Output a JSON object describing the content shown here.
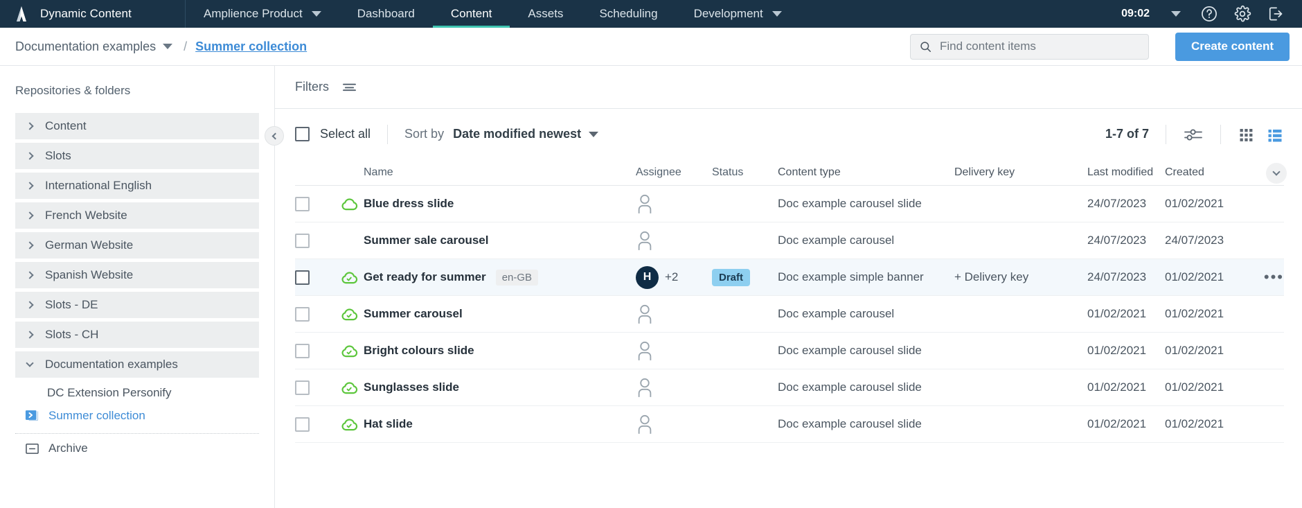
{
  "topnav": {
    "logo_icon": "amplience-logo-icon",
    "brand": "Dynamic Content",
    "product_switcher": {
      "label": "Amplience Product",
      "icon": "chevron-down-icon"
    },
    "items": [
      {
        "label": "Dashboard",
        "active": false
      },
      {
        "label": "Content",
        "active": true
      },
      {
        "label": "Assets",
        "active": false
      },
      {
        "label": "Scheduling",
        "active": false
      },
      {
        "label": "Development",
        "active": false,
        "icon": "chevron-down-icon"
      }
    ],
    "clock": "09:02",
    "clock_caret_icon": "chevron-down-icon",
    "help_icon": "help-circle-icon",
    "settings_icon": "gear-icon",
    "logout_icon": "logout-icon"
  },
  "breadcrumb": {
    "root": "Documentation examples",
    "root_caret_icon": "chevron-down-icon",
    "separator": "/",
    "current": "Summer collection"
  },
  "search": {
    "icon": "search-icon",
    "value": "",
    "placeholder": "Find content items"
  },
  "create_button": {
    "label": "Create content",
    "color": "#4a9ae0"
  },
  "sidebar": {
    "heading": "Repositories & folders",
    "collapse_icon": "chevron-left-icon",
    "items": [
      {
        "label": "Content",
        "icon": "chevron-right-icon",
        "expanded": false
      },
      {
        "label": "Slots",
        "icon": "chevron-right-icon",
        "expanded": false
      },
      {
        "label": "International English",
        "icon": "chevron-right-icon",
        "expanded": false
      },
      {
        "label": "French Website",
        "icon": "chevron-right-icon",
        "expanded": false
      },
      {
        "label": "German Website",
        "icon": "chevron-right-icon",
        "expanded": false
      },
      {
        "label": "Spanish Website",
        "icon": "chevron-right-icon",
        "expanded": false
      },
      {
        "label": "Slots - DE",
        "icon": "chevron-right-icon",
        "expanded": false
      },
      {
        "label": "Slots - CH",
        "icon": "chevron-right-icon",
        "expanded": false
      },
      {
        "label": "Documentation examples",
        "icon": "chevron-down-icon",
        "expanded": true
      }
    ],
    "children": [
      {
        "label": "DC Extension Personify",
        "selected": false
      },
      {
        "label": "Summer collection",
        "selected": true,
        "icon": "folder-open-icon"
      }
    ],
    "archive": {
      "label": "Archive",
      "icon": "archive-box-icon"
    }
  },
  "filters": {
    "label": "Filters",
    "icon": "filter-icon"
  },
  "expand_panel_icon": "chevron-down-icon",
  "toolbar": {
    "select_all_label": "Select all",
    "select_all_checked": false,
    "sort_by_label": "Sort by",
    "sort_value": "Date modified newest",
    "sort_caret_icon": "chevron-down-icon",
    "pager": "1-7 of 7",
    "settings_icon": "sliders-icon",
    "grid_view_icon": "grid-view-icon",
    "list_view_icon": "list-view-icon",
    "active_view": "list"
  },
  "table": {
    "columns": [
      "Name",
      "Assignee",
      "Status",
      "Content type",
      "Delivery key",
      "Last modified",
      "Created"
    ],
    "rows": [
      {
        "name": "Blue dress slide",
        "locale": "",
        "published_icon": "cloud-icon",
        "published_state": "published",
        "assignee_initial": "",
        "assignee_extra": "",
        "status": "",
        "content_type": "Doc example carousel slide",
        "delivery_key": "",
        "last_modified": "24/07/2023",
        "created": "01/02/2021",
        "highlighted": false,
        "menu_icon": ""
      },
      {
        "name": "Summer sale carousel",
        "locale": "",
        "published_icon": "",
        "published_state": "none",
        "assignee_initial": "",
        "assignee_extra": "",
        "status": "",
        "content_type": "Doc example carousel",
        "delivery_key": "",
        "last_modified": "24/07/2023",
        "created": "24/07/2023",
        "highlighted": false,
        "menu_icon": ""
      },
      {
        "name": "Get ready for summer",
        "locale": "en-GB",
        "published_icon": "cloud-check-icon",
        "published_state": "published-changed",
        "assignee_initial": "H",
        "assignee_extra": "+2",
        "status": "Draft",
        "content_type": "Doc example simple banner",
        "delivery_key": "+ Delivery key",
        "last_modified": "24/07/2023",
        "created": "01/02/2021",
        "highlighted": true,
        "menu_icon": "more-options-icon"
      },
      {
        "name": "Summer carousel",
        "locale": "",
        "published_icon": "cloud-check-icon",
        "published_state": "published-changed",
        "assignee_initial": "",
        "assignee_extra": "",
        "status": "",
        "content_type": "Doc example carousel",
        "delivery_key": "",
        "last_modified": "01/02/2021",
        "created": "01/02/2021",
        "highlighted": false,
        "menu_icon": ""
      },
      {
        "name": "Bright colours slide",
        "locale": "",
        "published_icon": "cloud-check-icon",
        "published_state": "published-changed",
        "assignee_initial": "",
        "assignee_extra": "",
        "status": "",
        "content_type": "Doc example carousel slide",
        "delivery_key": "",
        "last_modified": "01/02/2021",
        "created": "01/02/2021",
        "highlighted": false,
        "menu_icon": ""
      },
      {
        "name": "Sunglasses slide",
        "locale": "",
        "published_icon": "cloud-check-icon",
        "published_state": "published-changed",
        "assignee_initial": "",
        "assignee_extra": "",
        "status": "",
        "content_type": "Doc example carousel slide",
        "delivery_key": "",
        "last_modified": "01/02/2021",
        "created": "01/02/2021",
        "highlighted": false,
        "menu_icon": ""
      },
      {
        "name": "Hat slide",
        "locale": "",
        "published_icon": "cloud-check-icon",
        "published_state": "published-changed",
        "assignee_initial": "",
        "assignee_extra": "",
        "status": "",
        "content_type": "Doc example carousel slide",
        "delivery_key": "",
        "last_modified": "01/02/2021",
        "created": "01/02/2021",
        "highlighted": false,
        "menu_icon": ""
      }
    ]
  },
  "colors": {
    "topnav_bg": "#1a3347",
    "accent_teal": "#3ec4b0",
    "link_blue": "#3d8bd6",
    "primary_blue": "#4a9ae0",
    "published_green": "#5cc63c",
    "draft_badge": "#8ecff0",
    "avatar_navy": "#0f2c45",
    "row_highlight": "#f3f8fc"
  }
}
